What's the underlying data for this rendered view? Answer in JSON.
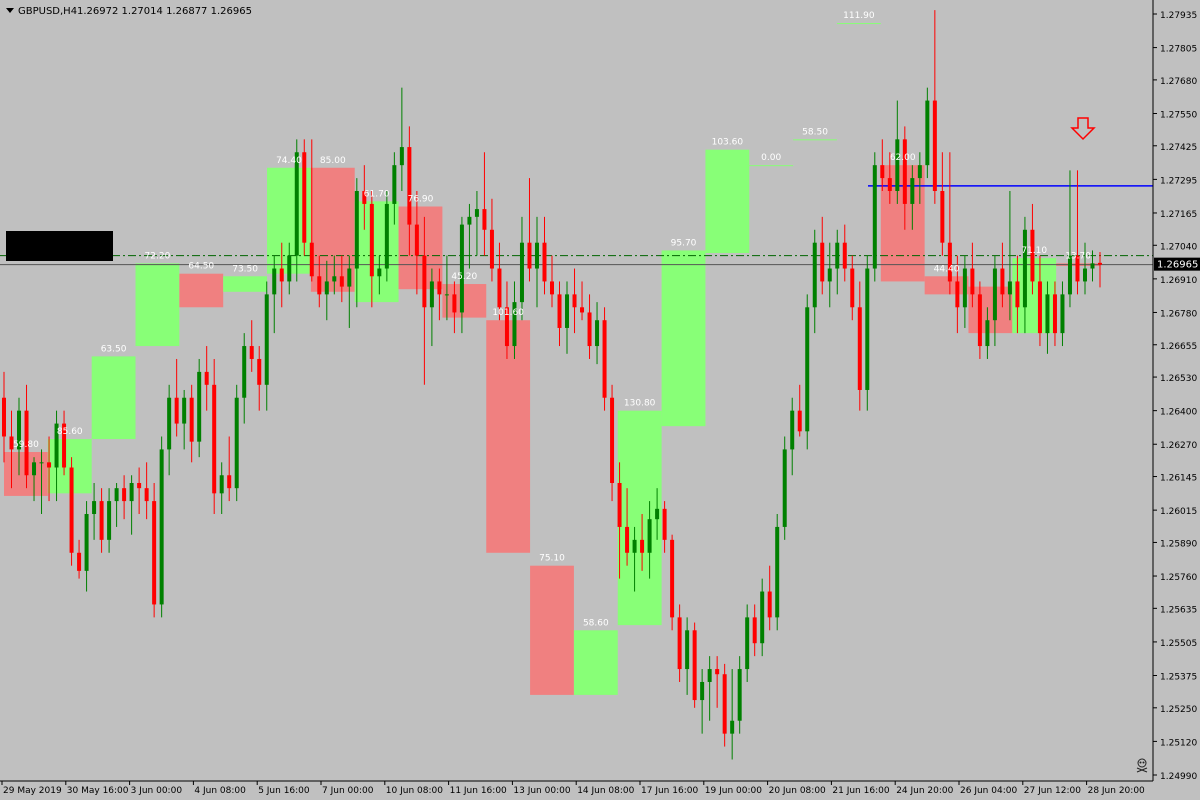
{
  "header": {
    "symbol": "GBPUSD,H4",
    "ohlc": "1.26972 1.27014 1.26877 1.26965",
    "menu_icon": "triangle-down-icon"
  },
  "colors": {
    "background": "#c0c0c0",
    "bull_body": "#008000",
    "bear_body": "#ff0000",
    "bull_box": "#88ff77",
    "bear_box": "#f08080",
    "axis": "#000000",
    "resistance_line": "#0000ff",
    "dashed_line": "#006400",
    "current_price_bg": "#000000",
    "label_text": "#ffffff",
    "arrow": "#ff0000"
  },
  "price_axis": {
    "ticks": [
      "1.27935",
      "1.27805",
      "1.27680",
      "1.27550",
      "1.27425",
      "1.27295",
      "1.27165",
      "1.27040",
      "1.26910",
      "1.26780",
      "1.26655",
      "1.26530",
      "1.26400",
      "1.26270",
      "1.26145",
      "1.26015",
      "1.25890",
      "1.25760",
      "1.25635",
      "1.25505",
      "1.25375",
      "1.25250",
      "1.25120",
      "1.24990"
    ],
    "current_price": "1.26965"
  },
  "time_axis": {
    "labels": [
      "29 May 2019",
      "30 May 16:00",
      "3 Jun 00:00",
      "4 Jun 08:00",
      "5 Jun 16:00",
      "7 Jun 00:00",
      "10 Jun 08:00",
      "11 Jun 16:00",
      "13 Jun 00:00",
      "14 Jun 08:00",
      "17 Jun 16:00",
      "19 Jun 00:00",
      "20 Jun 08:00",
      "21 Jun 16:00",
      "24 Jun 20:00",
      "26 Jun 04:00",
      "27 Jun 12:00",
      "28 Jun 20:00"
    ]
  },
  "misc": {
    "corner_icon": "skull-icon",
    "sell_arrow_icon": "down-arrow-icon"
  },
  "chart_data": {
    "type": "candlestick",
    "title": "",
    "symbol": "GBPUSD",
    "timeframe": "H4",
    "ylim": [
      1.2499,
      1.28
    ],
    "ohlc_last": {
      "open": 1.26972,
      "high": 1.27014,
      "low": 1.26877,
      "close": 1.26965
    },
    "resistance_level": 1.2727,
    "dashed_level": 1.27,
    "current_price": 1.26965,
    "boxes": [
      {
        "dir": "bear",
        "label": "59.80",
        "top": 1.2624,
        "bottom": 1.2607
      },
      {
        "dir": "bull",
        "label": "85.60",
        "top": 1.2629,
        "bottom": 1.2608
      },
      {
        "dir": "bull",
        "label": "63.50",
        "top": 1.2661,
        "bottom": 1.2629
      },
      {
        "dir": "bull",
        "label": "72.20",
        "top": 1.2697,
        "bottom": 1.2665
      },
      {
        "dir": "bear",
        "label": "64.50",
        "top": 1.2693,
        "bottom": 1.268
      },
      {
        "dir": "bull",
        "label": "73.50",
        "top": 1.2692,
        "bottom": 1.2686
      },
      {
        "dir": "bull",
        "label": "74.40",
        "top": 1.2734,
        "bottom": 1.2693
      },
      {
        "dir": "bear",
        "label": "85.00",
        "top": 1.2734,
        "bottom": 1.2686
      },
      {
        "dir": "bull",
        "label": "61.70",
        "top": 1.2721,
        "bottom": 1.2682
      },
      {
        "dir": "bear",
        "label": "76.90",
        "top": 1.2719,
        "bottom": 1.2687
      },
      {
        "dir": "bear",
        "label": "45.20",
        "top": 1.2689,
        "bottom": 1.2676
      },
      {
        "dir": "bear",
        "label": "101.60",
        "top": 1.2675,
        "bottom": 1.2585
      },
      {
        "dir": "bear",
        "label": "75.10",
        "top": 1.258,
        "bottom": 1.253
      },
      {
        "dir": "bull",
        "label": "58.60",
        "top": 1.2555,
        "bottom": 1.253
      },
      {
        "dir": "bull",
        "label": "130.80",
        "top": 1.264,
        "bottom": 1.2557
      },
      {
        "dir": "bull",
        "label": "95.70",
        "top": 1.2702,
        "bottom": 1.2634
      },
      {
        "dir": "bull",
        "label": "103.60",
        "top": 1.2741,
        "bottom": 1.2701
      },
      {
        "dir": "bull",
        "label": "0.00",
        "top": 1.2735,
        "bottom": 1.2735
      },
      {
        "dir": "bull",
        "label": "58.50",
        "top": 1.2745,
        "bottom": 1.2745
      },
      {
        "dir": "bull",
        "label": "111.90",
        "top": 1.279,
        "bottom": 1.279
      },
      {
        "dir": "bear",
        "label": "62.00",
        "top": 1.2735,
        "bottom": 1.269
      },
      {
        "dir": "bear",
        "label": "44.40",
        "top": 1.2692,
        "bottom": 1.2685
      },
      {
        "dir": "bear",
        "label": "",
        "top": 1.2688,
        "bottom": 1.267
      },
      {
        "dir": "bull",
        "label": "71.10",
        "top": 1.2699,
        "bottom": 1.267
      },
      {
        "dir": "bear",
        "label": "13.70",
        "top": 1.2697,
        "bottom": 1.2696
      }
    ],
    "candles": [
      [
        1.2645,
        1.2655,
        1.262,
        1.263
      ],
      [
        1.263,
        1.264,
        1.261,
        1.2625
      ],
      [
        1.2625,
        1.2645,
        1.2615,
        1.264
      ],
      [
        1.264,
        1.265,
        1.261,
        1.2615
      ],
      [
        1.2615,
        1.2622,
        1.2605,
        1.262
      ],
      [
        1.262,
        1.2625,
        1.26,
        1.262
      ],
      [
        1.262,
        1.263,
        1.2605,
        1.2618
      ],
      [
        1.2618,
        1.264,
        1.2605,
        1.2635
      ],
      [
        1.2635,
        1.264,
        1.2615,
        1.2618
      ],
      [
        1.2618,
        1.2622,
        1.258,
        1.2585
      ],
      [
        1.2585,
        1.259,
        1.2575,
        1.2578
      ],
      [
        1.2578,
        1.2605,
        1.257,
        1.26
      ],
      [
        1.26,
        1.2612,
        1.259,
        1.2605
      ],
      [
        1.2605,
        1.261,
        1.2585,
        1.259
      ],
      [
        1.259,
        1.261,
        1.2585,
        1.2605
      ],
      [
        1.2605,
        1.2612,
        1.2595,
        1.261
      ],
      [
        1.261,
        1.2615,
        1.2598,
        1.2605
      ],
      [
        1.2605,
        1.2615,
        1.2592,
        1.2612
      ],
      [
        1.2612,
        1.2618,
        1.26,
        1.261
      ],
      [
        1.261,
        1.262,
        1.2598,
        1.2605
      ],
      [
        1.2605,
        1.2612,
        1.256,
        1.2565
      ],
      [
        1.2565,
        1.263,
        1.256,
        1.2625
      ],
      [
        1.2625,
        1.265,
        1.2615,
        1.2645
      ],
      [
        1.2645,
        1.266,
        1.263,
        1.2635
      ],
      [
        1.2635,
        1.2648,
        1.2625,
        1.2645
      ],
      [
        1.2645,
        1.265,
        1.262,
        1.2628
      ],
      [
        1.2628,
        1.266,
        1.2622,
        1.2655
      ],
      [
        1.2655,
        1.2665,
        1.264,
        1.265
      ],
      [
        1.265,
        1.266,
        1.26,
        1.2608
      ],
      [
        1.2608,
        1.262,
        1.26,
        1.2615
      ],
      [
        1.2615,
        1.263,
        1.2605,
        1.261
      ],
      [
        1.261,
        1.265,
        1.2605,
        1.2645
      ],
      [
        1.2645,
        1.267,
        1.2635,
        1.2665
      ],
      [
        1.2665,
        1.2675,
        1.2655,
        1.266
      ],
      [
        1.266,
        1.2665,
        1.264,
        1.265
      ],
      [
        1.265,
        1.269,
        1.264,
        1.2685
      ],
      [
        1.2685,
        1.27,
        1.267,
        1.2695
      ],
      [
        1.2695,
        1.2705,
        1.268,
        1.269
      ],
      [
        1.269,
        1.2705,
        1.2685,
        1.27
      ],
      [
        1.27,
        1.2745,
        1.269,
        1.274
      ],
      [
        1.274,
        1.2745,
        1.27,
        1.2705
      ],
      [
        1.2705,
        1.2745,
        1.269,
        1.2692
      ],
      [
        1.2692,
        1.27,
        1.268,
        1.2685
      ],
      [
        1.2685,
        1.2698,
        1.2675,
        1.269
      ],
      [
        1.269,
        1.27,
        1.2685,
        1.2692
      ],
      [
        1.2692,
        1.27,
        1.2682,
        1.2688
      ],
      [
        1.2688,
        1.27,
        1.2672,
        1.2695
      ],
      [
        1.2695,
        1.273,
        1.268,
        1.2725
      ],
      [
        1.2725,
        1.2735,
        1.271,
        1.272
      ],
      [
        1.272,
        1.2725,
        1.268,
        1.2692
      ],
      [
        1.2692,
        1.27,
        1.2685,
        1.2695
      ],
      [
        1.2695,
        1.2725,
        1.269,
        1.272
      ],
      [
        1.272,
        1.274,
        1.2712,
        1.2735
      ],
      [
        1.2735,
        1.2765,
        1.2725,
        1.2742
      ],
      [
        1.2742,
        1.275,
        1.27,
        1.2712
      ],
      [
        1.2712,
        1.2725,
        1.2685,
        1.27
      ],
      [
        1.27,
        1.2715,
        1.265,
        1.268
      ],
      [
        1.268,
        1.2695,
        1.2665,
        1.269
      ],
      [
        1.269,
        1.2695,
        1.2675,
        1.2685
      ],
      [
        1.2685,
        1.27,
        1.2675,
        1.2685
      ],
      [
        1.2685,
        1.269,
        1.267,
        1.2678
      ],
      [
        1.2678,
        1.2715,
        1.267,
        1.2712
      ],
      [
        1.2712,
        1.272,
        1.2695,
        1.2715
      ],
      [
        1.2715,
        1.2725,
        1.27,
        1.2718
      ],
      [
        1.2718,
        1.274,
        1.27,
        1.271
      ],
      [
        1.271,
        1.2722,
        1.269,
        1.2695
      ],
      [
        1.2695,
        1.2705,
        1.2675,
        1.268
      ],
      [
        1.268,
        1.269,
        1.266,
        1.2665
      ],
      [
        1.2665,
        1.269,
        1.266,
        1.2682
      ],
      [
        1.2682,
        1.2715,
        1.2675,
        1.2705
      ],
      [
        1.2705,
        1.273,
        1.269,
        1.2695
      ],
      [
        1.2695,
        1.2715,
        1.268,
        1.2705
      ],
      [
        1.2705,
        1.2715,
        1.2685,
        1.269
      ],
      [
        1.269,
        1.27,
        1.268,
        1.2685
      ],
      [
        1.2685,
        1.269,
        1.2665,
        1.2672
      ],
      [
        1.2672,
        1.269,
        1.2662,
        1.2685
      ],
      [
        1.2685,
        1.2695,
        1.267,
        1.268
      ],
      [
        1.268,
        1.269,
        1.2675,
        1.2678
      ],
      [
        1.2678,
        1.2685,
        1.266,
        1.2665
      ],
      [
        1.2665,
        1.2682,
        1.2658,
        1.2675
      ],
      [
        1.2675,
        1.268,
        1.264,
        1.2645
      ],
      [
        1.2645,
        1.265,
        1.2605,
        1.2612
      ],
      [
        1.2612,
        1.262,
        1.2575,
        1.2595
      ],
      [
        1.2595,
        1.261,
        1.258,
        1.2585
      ],
      [
        1.2585,
        1.2595,
        1.257,
        1.259
      ],
      [
        1.259,
        1.26,
        1.2578,
        1.2585
      ],
      [
        1.2585,
        1.2605,
        1.2575,
        1.2598
      ],
      [
        1.2598,
        1.261,
        1.259,
        1.2602
      ],
      [
        1.2602,
        1.2605,
        1.2585,
        1.259
      ],
      [
        1.259,
        1.2592,
        1.2555,
        1.256
      ],
      [
        1.256,
        1.2565,
        1.2535,
        1.254
      ],
      [
        1.254,
        1.256,
        1.253,
        1.2555
      ],
      [
        1.2555,
        1.2558,
        1.2525,
        1.2528
      ],
      [
        1.2528,
        1.254,
        1.2515,
        1.2535
      ],
      [
        1.2535,
        1.2545,
        1.252,
        1.254
      ],
      [
        1.254,
        1.2545,
        1.2525,
        1.2538
      ],
      [
        1.2538,
        1.2542,
        1.251,
        1.2515
      ],
      [
        1.2515,
        1.254,
        1.2505,
        1.252
      ],
      [
        1.252,
        1.2545,
        1.2515,
        1.254
      ],
      [
        1.254,
        1.2565,
        1.2535,
        1.256
      ],
      [
        1.256,
        1.2565,
        1.2545,
        1.255
      ],
      [
        1.255,
        1.2575,
        1.2545,
        1.257
      ],
      [
        1.257,
        1.258,
        1.2555,
        1.256
      ],
      [
        1.256,
        1.26,
        1.2555,
        1.2595
      ],
      [
        1.2595,
        1.263,
        1.259,
        1.2625
      ],
      [
        1.2625,
        1.2645,
        1.2615,
        1.264
      ],
      [
        1.264,
        1.265,
        1.263,
        1.2632
      ],
      [
        1.2632,
        1.2685,
        1.2625,
        1.268
      ],
      [
        1.268,
        1.271,
        1.267,
        1.2705
      ],
      [
        1.2705,
        1.2715,
        1.2685,
        1.269
      ],
      [
        1.269,
        1.2705,
        1.268,
        1.2695
      ],
      [
        1.2695,
        1.271,
        1.2685,
        1.2705
      ],
      [
        1.2705,
        1.2712,
        1.269,
        1.2695
      ],
      [
        1.2695,
        1.27,
        1.2675,
        1.268
      ],
      [
        1.268,
        1.269,
        1.264,
        1.2648
      ],
      [
        1.2648,
        1.27,
        1.264,
        1.2695
      ],
      [
        1.2695,
        1.274,
        1.269,
        1.2735
      ],
      [
        1.2735,
        1.2745,
        1.2725,
        1.273
      ],
      [
        1.273,
        1.274,
        1.272,
        1.2725
      ],
      [
        1.2725,
        1.276,
        1.272,
        1.2745
      ],
      [
        1.2745,
        1.275,
        1.271,
        1.272
      ],
      [
        1.272,
        1.2735,
        1.271,
        1.273
      ],
      [
        1.273,
        1.274,
        1.272,
        1.2735
      ],
      [
        1.2735,
        1.2765,
        1.273,
        1.276
      ],
      [
        1.276,
        1.2795,
        1.272,
        1.2725
      ],
      [
        1.2725,
        1.274,
        1.27,
        1.2705
      ],
      [
        1.2705,
        1.274,
        1.2685,
        1.269
      ],
      [
        1.269,
        1.27,
        1.267,
        1.268
      ],
      [
        1.268,
        1.27,
        1.2672,
        1.2695
      ],
      [
        1.2695,
        1.2705,
        1.268,
        1.2685
      ],
      [
        1.2685,
        1.269,
        1.266,
        1.2665
      ],
      [
        1.2665,
        1.268,
        1.266,
        1.2675
      ],
      [
        1.2675,
        1.27,
        1.2665,
        1.2695
      ],
      [
        1.2695,
        1.2705,
        1.268,
        1.2685
      ],
      [
        1.2685,
        1.2725,
        1.2675,
        1.269
      ],
      [
        1.269,
        1.27,
        1.267,
        1.268
      ],
      [
        1.268,
        1.2715,
        1.267,
        1.271
      ],
      [
        1.271,
        1.272,
        1.2685,
        1.269
      ],
      [
        1.269,
        1.27,
        1.2665,
        1.267
      ],
      [
        1.267,
        1.269,
        1.2662,
        1.2685
      ],
      [
        1.2685,
        1.269,
        1.2665,
        1.267
      ],
      [
        1.267,
        1.269,
        1.2665,
        1.2685
      ],
      [
        1.2685,
        1.2733,
        1.268,
        1.27
      ],
      [
        1.27,
        1.2733,
        1.2685,
        1.269
      ],
      [
        1.269,
        1.2705,
        1.2685,
        1.2695
      ],
      [
        1.2695,
        1.2702,
        1.269,
        1.2697
      ],
      [
        1.26972,
        1.27014,
        1.26877,
        1.26965
      ]
    ]
  }
}
